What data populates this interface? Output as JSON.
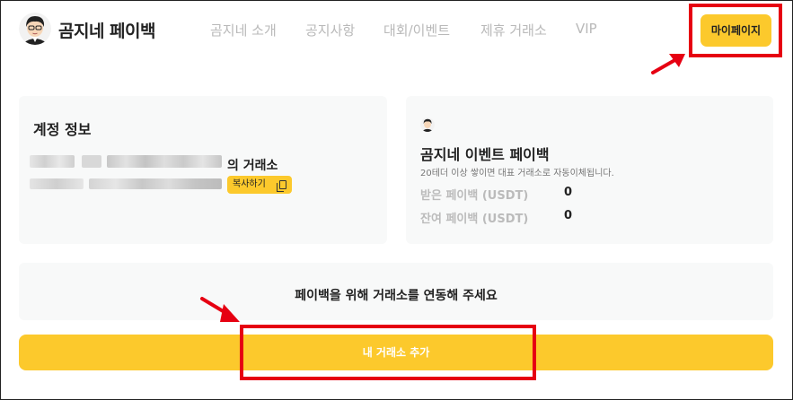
{
  "header": {
    "brand": "곰지네 페이백",
    "nav": [
      "곰지네 소개",
      "공지사항",
      "대회/이벤트",
      "제휴 거래소",
      "VIP"
    ],
    "mypage_label": "마이페이지"
  },
  "account": {
    "title": "계정 정보",
    "exchange_suffix": "의 거래소",
    "copy_label": "복사하기"
  },
  "event": {
    "title": "곰지네 이벤트 페이백",
    "description": "20테더 이상 쌓이면 대표 거래소로 자동이체됩니다.",
    "received_label": "받은 페이백 (USDT)",
    "received_value": "0",
    "remaining_label": "잔여 페이백 (USDT)",
    "remaining_value": "0"
  },
  "link": {
    "message": "페이백을 위해 거래소를 연동해 주세요",
    "add_button": "내 거래소 추가"
  },
  "colors": {
    "accent": "#fcc92c",
    "annotation_red": "#e60012"
  }
}
